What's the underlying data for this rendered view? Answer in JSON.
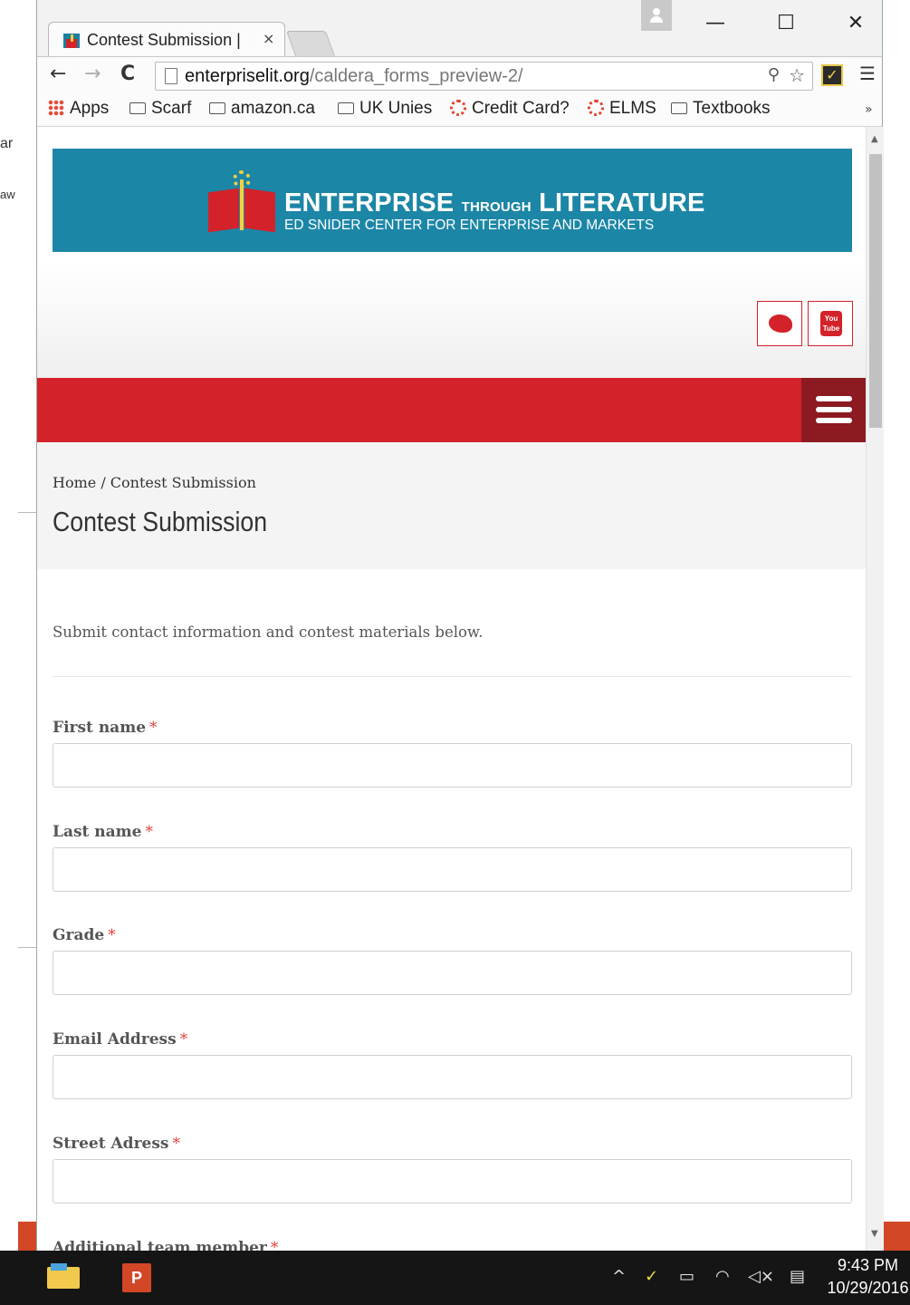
{
  "desktop": {
    "left_fragments": [
      "ar",
      "aw"
    ]
  },
  "browser": {
    "tab": {
      "title": "Contest Submission |",
      "close_glyph": "×"
    },
    "window_controls": {
      "minimize": "—",
      "maximize": "☐",
      "close": "✕"
    },
    "address": {
      "host": "enterpriselit.org",
      "path": "/caldera_forms_preview-2/"
    },
    "bookmarks": [
      {
        "label": "Apps",
        "icon": "apps-grid-icon"
      },
      {
        "label": "Scarf",
        "icon": "folder-icon"
      },
      {
        "label": "amazon.ca",
        "icon": "folder-icon"
      },
      {
        "label": "UK Unies",
        "icon": "folder-icon"
      },
      {
        "label": "Credit Card?",
        "icon": "ring-icon"
      },
      {
        "label": "ELMS",
        "icon": "ring-icon"
      },
      {
        "label": "Textbooks",
        "icon": "folder-icon"
      }
    ],
    "bookmarks_more": "»"
  },
  "site": {
    "logo": {
      "title_main": "ENTERPRISE",
      "title_small": "THROUGH",
      "title_end": "LITERATURE",
      "subtitle": "ED SNIDER CENTER FOR ENTERPRISE AND MARKETS"
    },
    "social": {
      "youtube_text_1": "You",
      "youtube_text_2": "Tube"
    },
    "colors": {
      "brand_blue": "#1c86a6",
      "brand_red": "#d3222a",
      "menu_dark_red": "#8c1a20"
    },
    "breadcrumb": {
      "home": "Home",
      "separator": " / ",
      "current": "Contest Submission"
    },
    "page_title": "Contest Submission",
    "intro": "Submit contact information and contest materials below.",
    "form": {
      "required_mark": "*",
      "fields": [
        {
          "label": "First name"
        },
        {
          "label": "Last name"
        },
        {
          "label": "Grade"
        },
        {
          "label": "Email Address"
        },
        {
          "label": "Street Adress"
        },
        {
          "label": "Additional team member"
        }
      ]
    }
  },
  "taskbar": {
    "ppt_label": "P",
    "time": "9:43 PM",
    "date": "10/29/2016"
  }
}
